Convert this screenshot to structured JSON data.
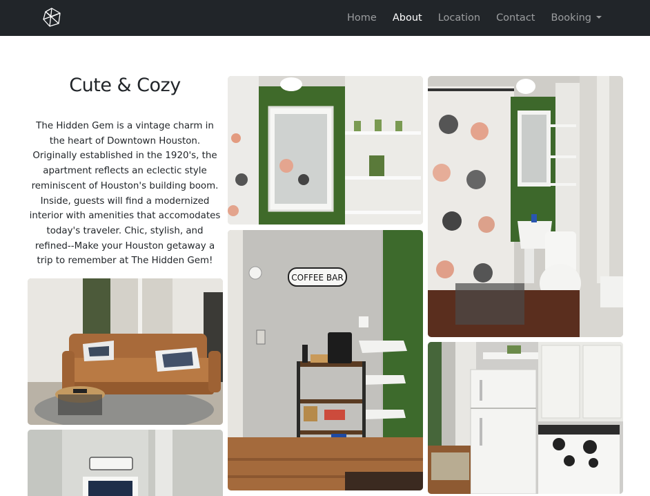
{
  "navbar": {
    "brand_icon": "gem-icon",
    "links": [
      {
        "label": "Home",
        "active": false
      },
      {
        "label": "About",
        "active": true
      },
      {
        "label": "Location",
        "active": false
      },
      {
        "label": "Contact",
        "active": false
      },
      {
        "label": "Booking",
        "active": false,
        "dropdown": true
      }
    ]
  },
  "about": {
    "title": "Cute & Cozy",
    "description": "The Hidden Gem is a vintage charm in the heart of Downtown Houston. Originally established in the 1920's, the apartment reflects an eclectic style reminiscent of Houston's building boom. Inside, guests will find a modernized interior with amenities that accomodates today's traveler. Chic, stylish, and refined--Make your Houston getaway a trip to remember at The Hidden Gem!"
  },
  "gallery": {
    "coffee_sign": "COFFEE BAR"
  },
  "colors": {
    "navbar_bg": "#212529",
    "nav_active": "#ffffff",
    "nav_inactive": "rgba(255,255,255,0.55)"
  }
}
